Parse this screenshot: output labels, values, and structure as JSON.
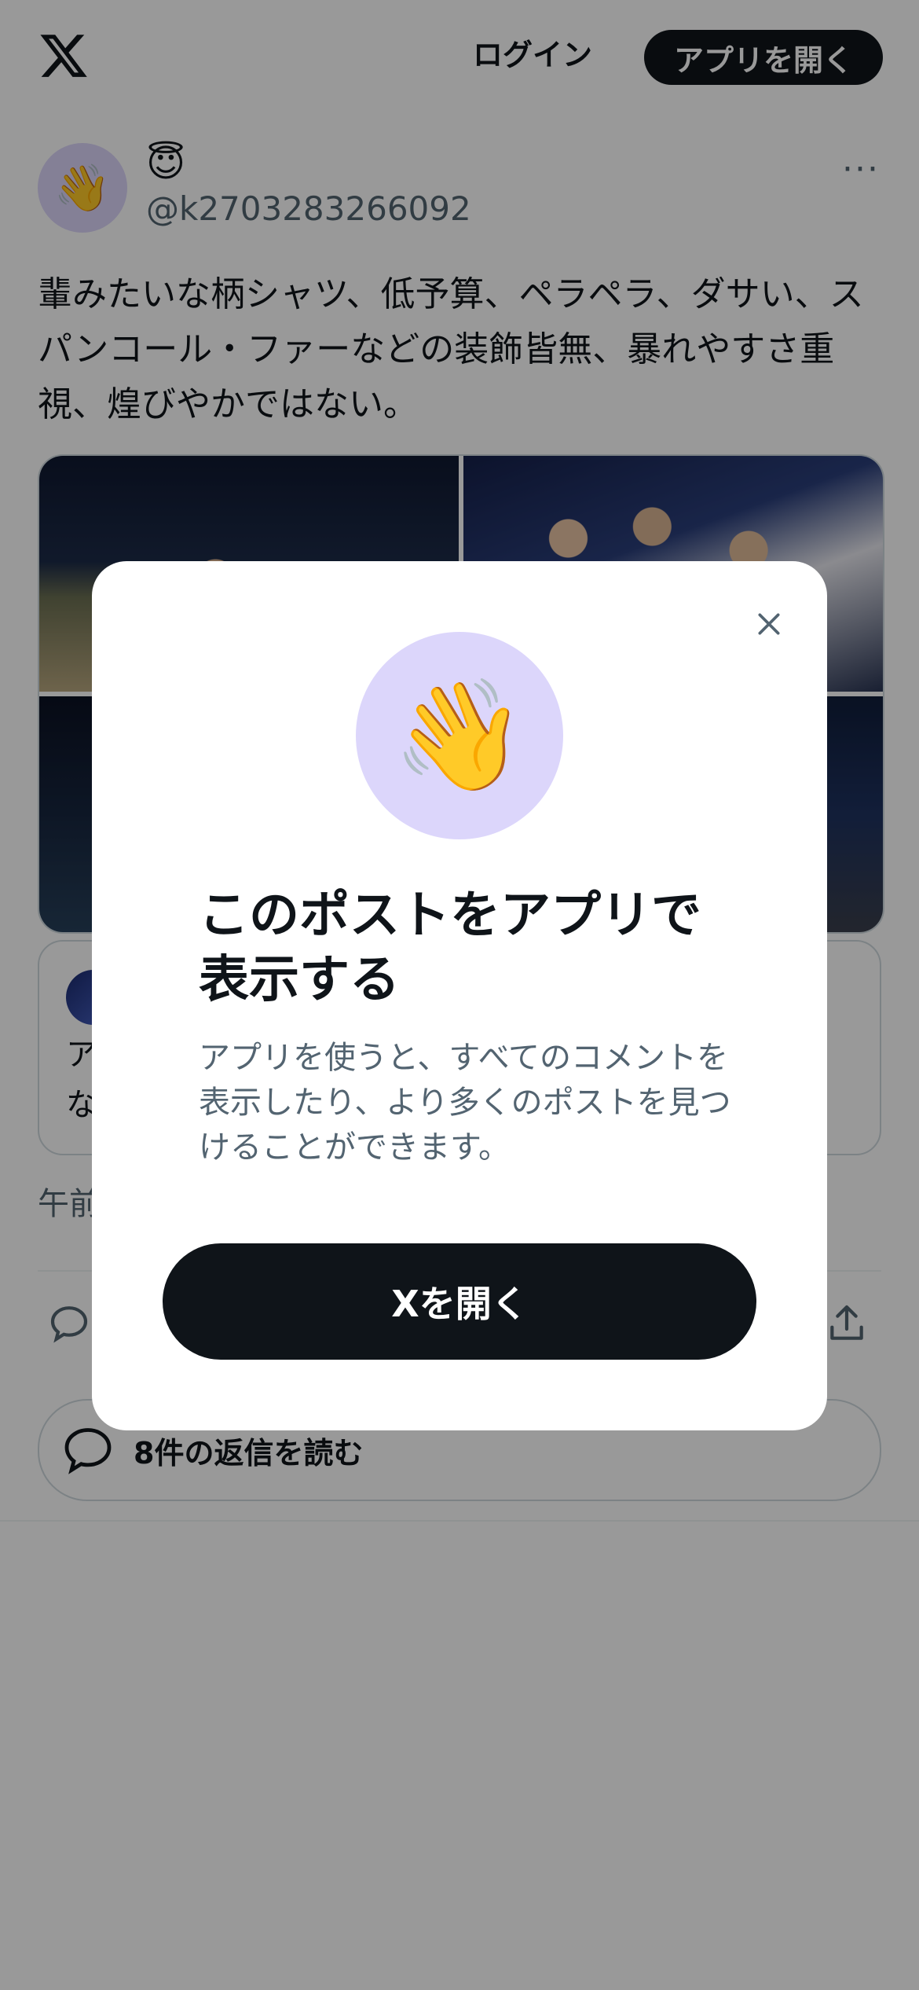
{
  "header": {
    "login_label": "ログイン",
    "open_app_label": "アプリを開く"
  },
  "post": {
    "author": {
      "avatar_emoji": "👋",
      "display_name": "😇",
      "handle": "@k2703283266092"
    },
    "more_label": "···",
    "text": "輩みたいな柄シャツ、低予算、ペラペラ、ダサい、スパンコール・ファーなどの装飾皆無、暴れやすさ重視、煌びやかではない。",
    "quoted": {
      "text_visible": "ア                                                   ん\nな"
    },
    "timestamp_visible": "午前",
    "read_replies_label": "8件の返信を読む"
  },
  "modal": {
    "emoji": "👋",
    "title": "このポストをアプリで表示する",
    "description": "アプリを使うと、すべてのコメントを表示したり、より多くのポストを見つけることができます。",
    "cta_label": "Xを開く",
    "close_icon": "close-icon"
  },
  "colors": {
    "text_primary": "#0f1419",
    "text_secondary": "#536471",
    "button_dark": "#0f1419",
    "avatar_bg": "#dcd6fb",
    "overlay": "rgba(0,0,0,0.4)"
  }
}
